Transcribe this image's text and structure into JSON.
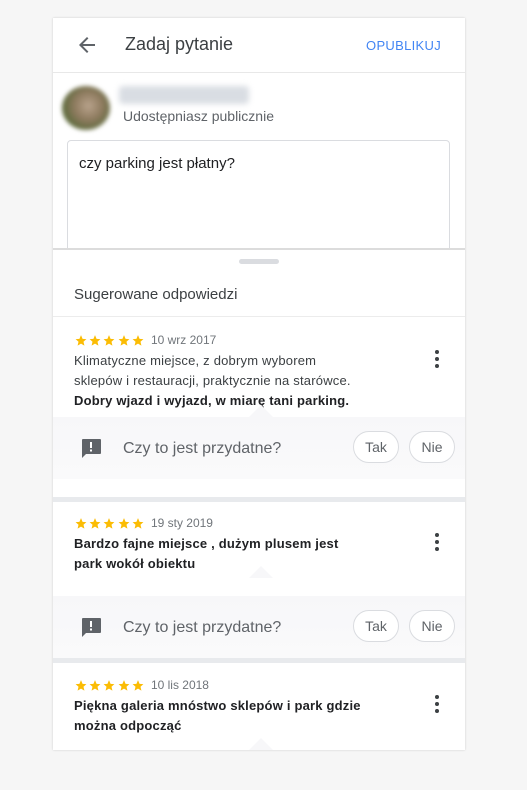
{
  "header": {
    "title": "Zadaj pytanie",
    "publish_label": "OPUBLIKUJ"
  },
  "author": {
    "share_info": "Udostępniasz publicznie"
  },
  "question": {
    "text": "czy parking jest płatny?"
  },
  "suggestions": {
    "title": "Sugerowane odpowiedzi",
    "helpful_prompt": "Czy to jest przydatne?",
    "yes_label": "Tak",
    "no_label": "Nie",
    "items": [
      {
        "rating": 5,
        "date": "10 wrz 2017",
        "lines": [
          "Klimatyczne miejsce, z dobrym wyborem",
          "sklepów i restauracji, praktycznie na starówce."
        ],
        "bold_lines": [
          "Dobry wjazd i wyjazd, w miarę tani parking."
        ]
      },
      {
        "rating": 5,
        "date": "19 sty 2019",
        "lines": [],
        "bold_lines": [
          "Bardzo fajne miejsce , dużym plusem jest",
          "park wokół obiektu"
        ]
      },
      {
        "rating": 5,
        "date": "10 lis 2018",
        "lines": [],
        "bold_lines": [
          "Piękna galeria mnóstwo sklepów i park gdzie",
          "można odpocząć"
        ]
      }
    ]
  },
  "colors": {
    "accent": "#4285f4",
    "star": "#fbbc04",
    "icon": "#5f6368"
  },
  "icons": {
    "back": "arrow-back-icon",
    "menu": "more-vert-icon",
    "feedback": "feedback-icon",
    "star": "star-icon"
  }
}
